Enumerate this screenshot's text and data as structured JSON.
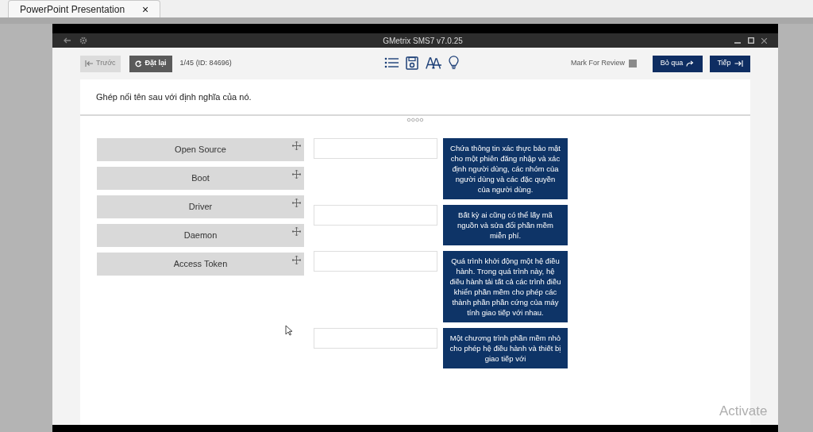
{
  "browser_tab": {
    "title": "PowerPoint Presentation",
    "close": "×"
  },
  "window": {
    "title": "GMetrix SMS7 v7.0.25"
  },
  "toolbar": {
    "back_button": {
      "label": "Trước",
      "disabled": true
    },
    "reset_button": {
      "label": "Đặt lại"
    },
    "counter": "1/45 (ID: 84696)",
    "mark_for_review": {
      "label": "Mark For Review",
      "checked": false
    },
    "skip_button": {
      "label": "Bỏ qua"
    },
    "next_button": {
      "label": "Tiếp"
    }
  },
  "question": "Ghép nối tên sau với định nghĩa của nó.",
  "terms": [
    "Open Source",
    "Boot",
    "Driver",
    "Daemon",
    "Access Token"
  ],
  "definitions": [
    {
      "text": "Chứa thông tin xác thực bảo mật cho một phiên đăng nhập và xác định người dùng, các nhóm của người dùng và các đặc quyền của người dùng."
    },
    {
      "text": "Bất kỳ ai cũng có thể lấy mã nguồn và sửa đổi phần mềm miễn phí."
    },
    {
      "text": "Quá trình khởi động một hệ điều hành. Trong quá trình này, hệ điều hành tải tất cả các trình điều khiển phần mềm cho phép các thành phần phần cứng của máy tính giao tiếp với nhau."
    },
    {
      "text": "Một chương trình phần mềm nhỏ cho phép hệ điều hành và thiết bị giao tiếp với"
    }
  ],
  "os_notice": "Activate"
}
